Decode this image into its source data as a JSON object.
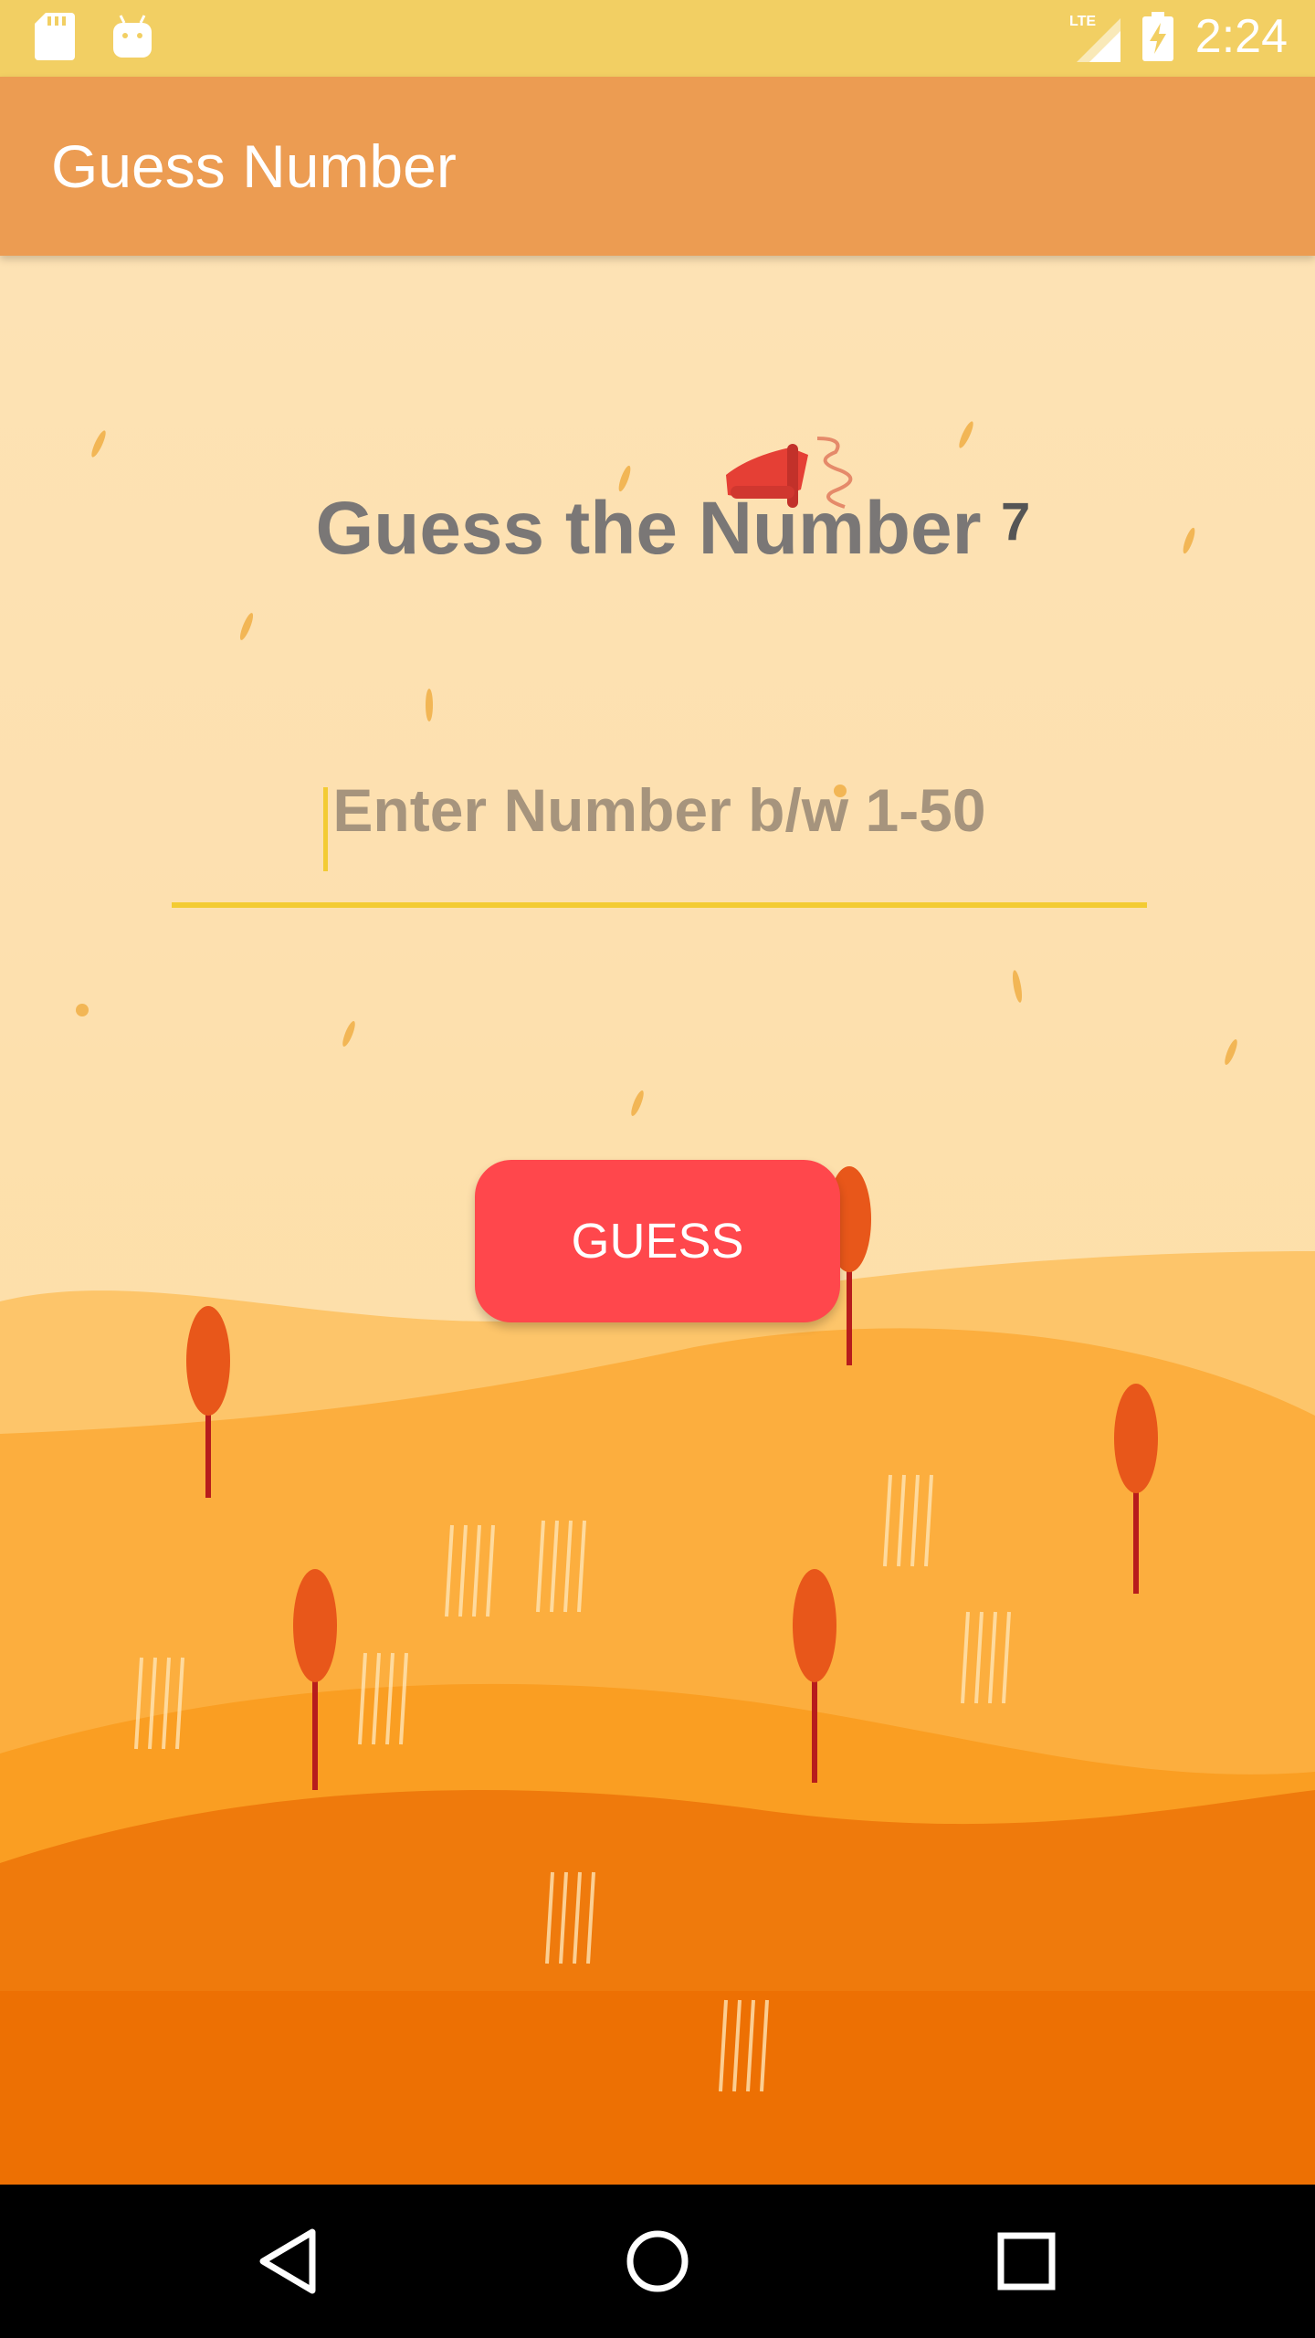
{
  "status_bar": {
    "time": "2:24",
    "network": "LTE",
    "icons": [
      "sd-card-icon",
      "android-icon",
      "signal-icon",
      "battery-charging-icon"
    ]
  },
  "app_bar": {
    "title": "Guess Number"
  },
  "main": {
    "heading": "Guess the Number",
    "superscript": "7",
    "input": {
      "placeholder": "Enter Number b/w 1-50",
      "value": ""
    },
    "guess_button_label": "GUESS"
  },
  "navigation": {
    "icons": [
      "back-icon",
      "home-icon",
      "recents-icon"
    ]
  },
  "colors": {
    "status_bar": "#F2CF63",
    "app_bar": "#EC9C52",
    "button": "#FF474C",
    "input_underline": "#F3CB33",
    "background": "#FDE0B0"
  }
}
